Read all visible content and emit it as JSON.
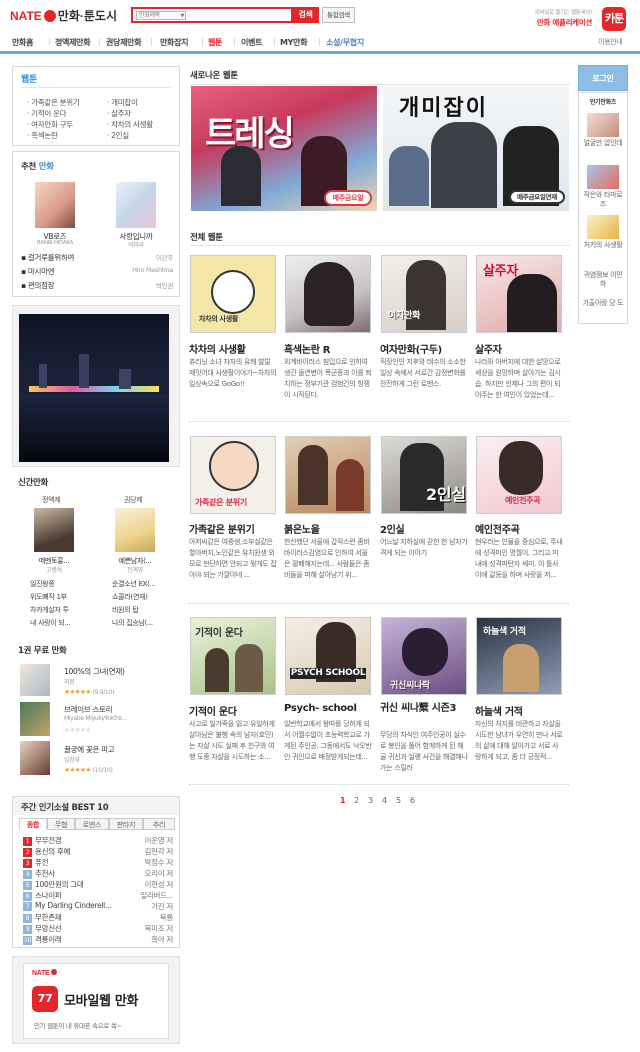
{
  "header": {
    "logo_text": "NATE",
    "service_name": "만화·툰도시",
    "search": {
      "scope_value": "만화제목",
      "button": "검색",
      "unified": "통합검색"
    },
    "app_promo_line1": "모바일로 즐기는 웹툰세상!",
    "app_promo_line2": "만화 애플리케이션",
    "app_icon_text": "카툰"
  },
  "gnb": [
    "만화홈",
    "정액제만화",
    "권당제만화",
    "만화잡지",
    "웹툰",
    "이벤트",
    "MY만화",
    "소설/무협지"
  ],
  "gnb_help": "이용안내",
  "left": {
    "webtoon": {
      "title": "웹툰",
      "col1": [
        "가족같은 분위기",
        "기적이 운다",
        "여자만화 구두",
        "흑색논란"
      ],
      "col2": [
        "개미잡이",
        "살주자",
        "차차의 사생활",
        "2인실"
      ]
    },
    "recommend": {
      "title_pre": "추천 ",
      "title_accent": "만화",
      "books": [
        {
          "title": "VB로즈",
          "author": "BANRI HIDAKA"
        },
        {
          "title": "사랑입니까",
          "author": "이미라"
        }
      ],
      "list": [
        {
          "title": "걸거루를위하여",
          "author": "이강주"
        },
        {
          "title": "마시마엔",
          "author": "Hiro Mashima"
        },
        {
          "title": "편의점장",
          "author": "박인권"
        }
      ]
    },
    "new": {
      "title": "신간만화",
      "col1_head": "정액제",
      "col2_head": "권당제",
      "books": [
        {
          "title": "메멘토흉...",
          "author": "고병석"
        },
        {
          "title": "예쁜남자(...",
          "author": "천계영"
        }
      ],
      "col1": [
        "일진왕쫑",
        "위도뼈작 1부",
        "차카게살자 투",
        "내 사랑이 되..."
      ],
      "col2": [
        "순결소년 EX(...",
        "쇼콜라(연재)",
        "비원의 탑",
        "나의 집승남(..."
      ]
    },
    "free": {
      "title": "1권 무료 만화",
      "items": [
        {
          "title": "100%의 그녀(연재)",
          "author": "지완",
          "score": "(9.9/10)"
        },
        {
          "title": "브레이브 스토리",
          "author": "Miyabe Miyuki/Yoichir...",
          "score": ""
        },
        {
          "title": "꿀궁에 꽃은 피고",
          "author": "임창욱",
          "score": "(10/10)"
        }
      ]
    },
    "novel": {
      "title": "주간 인기소설 BEST 10",
      "tabs": [
        "종합",
        "무협",
        "로맨스",
        "판타지",
        "추리"
      ],
      "items": [
        {
          "title": "무무전경",
          "author": "이운영 저"
        },
        {
          "title": "용신의 후예",
          "author": "김현각 저"
        },
        {
          "title": "퓨전",
          "author": "박정수 저"
        },
        {
          "title": "추천사",
          "author": "오리이 저"
        },
        {
          "title": "100만원의 그대",
          "author": "이현성 저"
        },
        {
          "title": "스나이퍼",
          "author": "일리버드..."
        },
        {
          "title": "My Darling Cinderell...",
          "author": "가진 저"
        },
        {
          "title": "무한존재",
          "author": "묵룡"
        },
        {
          "title": "무앙신선",
          "author": "북미조 저"
        },
        {
          "title": "격룡이래",
          "author": "흑야 저"
        }
      ]
    },
    "mobile": {
      "brand": "NATE",
      "title": "모바일웹 만화",
      "sub": "인기 웹툰이 내 휴대폰 속으로 쏙~"
    }
  },
  "main": {
    "new_title": "새로나온 웹툰",
    "banner1_text": "트레싱",
    "banner1_tag": "매주금요일",
    "banner2_text": "개미잡이",
    "banner2_tag": "매주금요일연재",
    "all_title": "전체 웹툰",
    "cards": [
      {
        "title": "차차의 사생활",
        "desc": "츄리닝 소녀 차차의 유쾌 발랄 재밋어대 사생활이야기~차차의 일상속으로 GoGo!!",
        "thumb": "차차의 사생활",
        "color": "#f4e6a8"
      },
      {
        "title": "흑색논란 R",
        "desc": "외계바이러스 침입으로 인하여 생긴 돌연변이 폭군종과 이를 퇴치하는 정부기관 검범간의 항쟁이 시작된다.",
        "thumb": "",
        "color": "#e7e0e1"
      },
      {
        "title": "여자만화(구두)",
        "desc": "직장인인 지후와 태수의 소소한 일상 속에서 서로간 감정변화를 잔잔하게 그린 로맨스.",
        "thumb": "여자만화",
        "color": "#e6dfd8"
      },
      {
        "title": "살주자",
        "desc": "나라와 아버지에 대한 살망으로 세상을 원망하며 살아가는 김시습. 하지만 언제나 그의 편이 되어주는 한 여인이 있었는데...",
        "thumb": "살주자",
        "color": "#f3d4d2"
      },
      {
        "title": "가족같은 분위기",
        "desc": "아저씨같은 여중생,소부실같은 할아버지,노인같은 유치원생 외모로 판단하면 안되고 뭣개도 잡아야 되는 가꺌이네 ...",
        "thumb": "가족같은 분위기",
        "color": "#f3f0e9"
      },
      {
        "title": "붉은노을",
        "desc": "한산했던 서울에 갑작스런 좀비 바이러스감염으로 인하여 서울은 황폐해지는데... 사람들은 좀비들을 피해 살아남기 위...",
        "thumb": "",
        "color": "#d8c2a8"
      },
      {
        "title": "2인실",
        "desc": "어느날 지하실에 갇힌 한 남자가 격게 되는 이야기",
        "thumb": "2인실",
        "color": "#cfcdc8"
      },
      {
        "title": "예인전주곡",
        "desc": "현우라는 인물을 중심으로, 주내에 성격미인 명월이, 그리고 미내에 성격파탄자 세미. 이 틀사이에 갈등을 하며 사랑을 저...",
        "thumb": "예인전주곡",
        "color": "#f4dfe4"
      },
      {
        "title": "기적이 운다",
        "desc": "사고로 일가족을 잃고 유일하게 살아남은 불행 속의 남자(호민)는 자살 시도 실패 후 친구와 여행 도중 자살을 시도하는 소...",
        "thumb": "기적이 운다",
        "color": "#dde7c8"
      },
      {
        "title": "Psych- school",
        "desc": "일반학교에서 왕따를 당하게 되서 어쩔수없이 초능력학교로 가게된 주인공. 그동에서도 낙오반인 귀인으로 배정받게되는데...",
        "thumb": "PSYCH SCHOOL",
        "color": "#e9e3d8"
      },
      {
        "title": "귀신 씨나櫱 시즌3",
        "desc": "무당의 자식인 여주인공이 실수로 봉인을 풀어 함께하게 된 해골 귀신과 실랭 사건을 해결해나가는 스릴러",
        "thumb": "귀신씨나락",
        "color": "#b7a6c4"
      },
      {
        "title": "하늘색 거적",
        "desc": "자신의 처지를 비관하고 자살을 시도한 남녀가 우연히 만나 서로의 삶에 대해 알아가고 서로 사랑하게 되고, 좀 더 긍정적...",
        "thumb": "하늘색 거적",
        "color": "#c8d7e6"
      }
    ],
    "pages": [
      "1",
      "2",
      "3",
      "4",
      "5",
      "6"
    ]
  },
  "right": {
    "login": "로그인",
    "popular_title": "인기만화츠",
    "items": [
      "얼굴만 압인데",
      "작은와 타마로즈",
      "처키의 사생활",
      "귀염쟁보 이민하",
      "가출이랑 당 도"
    ]
  }
}
